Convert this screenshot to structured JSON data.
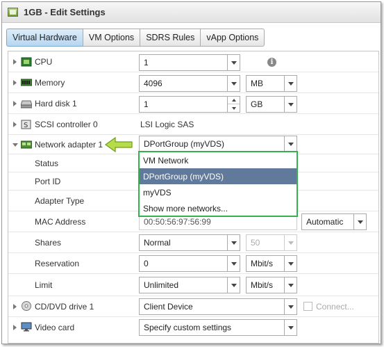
{
  "window": {
    "title": "1GB - Edit Settings"
  },
  "tabs": [
    {
      "label": "Virtual Hardware",
      "active": true
    },
    {
      "label": "VM Options",
      "active": false
    },
    {
      "label": "SDRS Rules",
      "active": false
    },
    {
      "label": "vApp Options",
      "active": false
    }
  ],
  "hardware": {
    "cpu": {
      "label": "CPU",
      "value": "1"
    },
    "memory": {
      "label": "Memory",
      "value": "4096",
      "unit": "MB"
    },
    "hard_disk": {
      "label": "Hard disk 1",
      "value": "1",
      "unit": "GB"
    },
    "scsi": {
      "label": "SCSI controller 0",
      "value": "LSI Logic SAS"
    },
    "network": {
      "label": "Network adapter 1",
      "value": "DPortGroup (myVDS)",
      "status_label": "Status",
      "port_id_label": "Port ID",
      "adapter_type_label": "Adapter Type",
      "mac_label": "MAC Address",
      "mac_value": "00:50:56:97:56:99",
      "mac_mode": "Automatic",
      "shares_label": "Shares",
      "shares_value": "Normal",
      "shares_amount": "50",
      "reservation_label": "Reservation",
      "reservation_value": "0",
      "reservation_unit": "Mbit/s",
      "limit_label": "Limit",
      "limit_value": "Unlimited",
      "limit_unit": "Mbit/s"
    },
    "cddvd": {
      "label": "CD/DVD drive 1",
      "value": "Client Device",
      "connect_label": "Connect..."
    },
    "video": {
      "label": "Video card",
      "value": "Specify custom settings"
    }
  },
  "network_dropdown": {
    "options": [
      "VM Network",
      "DPortGroup (myVDS)",
      "myVDS",
      "Show more networks..."
    ],
    "selected_index": 1
  },
  "colors": {
    "highlight_border": "#36b04a",
    "selected_option": "#617a9c",
    "active_tab": "#b8d6f0"
  }
}
